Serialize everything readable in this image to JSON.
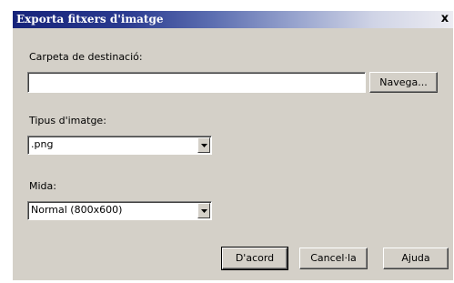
{
  "dialog": {
    "title": "Exporta fitxers d'imatge",
    "close_symbol": "x"
  },
  "destination": {
    "label": "Carpeta de destinació:",
    "value": "",
    "browse_label": "Navega..."
  },
  "image_type": {
    "label": "Tipus d'imatge:",
    "selected": ".png"
  },
  "size": {
    "label": "Mida:",
    "selected": "Normal (800x600)"
  },
  "buttons": {
    "ok_label": "D'acord",
    "cancel_label": "Cancel·la",
    "help_label": "Ajuda"
  },
  "colors": {
    "dialog_face": "#d4d0c8",
    "titlebar_start": "#16237a",
    "titlebar_end": "#ececf2"
  },
  "icons": {
    "close": "close-icon",
    "dropdown": "chevron-down-icon"
  }
}
